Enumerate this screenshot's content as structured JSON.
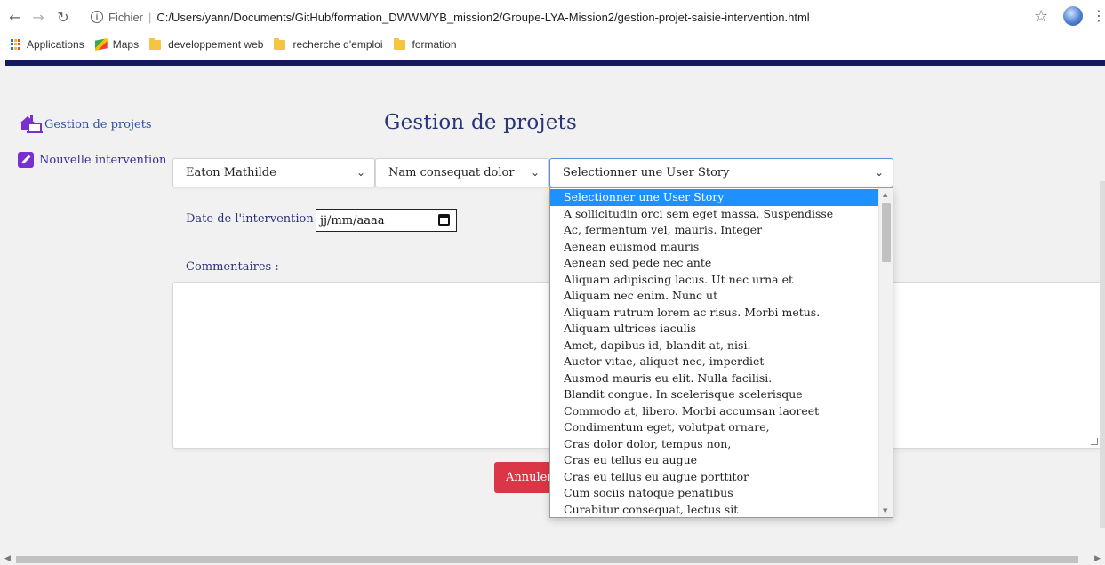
{
  "browser": {
    "url_scheme_label": "Fichier",
    "url_path": "C:/Users/yann/Documents/GitHub/formation_DWWM/YB_mission2/Groupe-LYA-Mission2/gestion-projet-saisie-intervention.html",
    "bookmarks": [
      "Applications",
      "Maps",
      "developpement web",
      "recherche d'emploi",
      "formation"
    ]
  },
  "sidebar": {
    "items": [
      {
        "label": "Gestion de projets",
        "icon": "home-icon"
      },
      {
        "label": "Nouvelle intervention",
        "icon": "edit-icon"
      }
    ]
  },
  "main": {
    "title": "Gestion de projets",
    "selects": {
      "developer": "Eaton Mathilde",
      "project": "Nam consequat dolor",
      "user_story": "Selectionner une User Story"
    },
    "date_label": "Date de l'intervention :",
    "date_placeholder": "jj/mm/aaaa",
    "comment_label": "Commentaires :",
    "comment_value": "",
    "cancel_label": "Annuler"
  },
  "dropdown": {
    "options": [
      "Selectionner une User Story",
      "A sollicitudin orci sem eget massa. Suspendisse",
      "Ac, fermentum vel, mauris. Integer",
      "Aenean euismod mauris",
      "Aenean sed pede nec ante",
      "Aliquam adipiscing lacus. Ut nec urna et",
      "Aliquam nec enim. Nunc ut",
      "Aliquam rutrum lorem ac risus. Morbi metus.",
      "Aliquam ultrices iaculis",
      "Amet, dapibus id, blandit at, nisi.",
      "Auctor vitae, aliquet nec, imperdiet",
      "Ausmod mauris eu elit. Nulla facilisi.",
      "Blandit congue. In scelerisque scelerisque",
      "Commodo at, libero. Morbi accumsan laoreet",
      "Condimentum eget, volutpat ornare,",
      "Cras dolor dolor, tempus non,",
      "Cras eu tellus eu augue",
      "Cras eu tellus eu augue porttitor",
      "Cum sociis natoque penatibus",
      "Curabitur consequat, lectus sit"
    ],
    "selected_index": 0
  },
  "colors": {
    "navy_band": "#141a5c",
    "title": "#2a3577",
    "link": "#2a51a6",
    "edit_icon": "#7a2fd1",
    "cancel_button": "#dc3545",
    "selection": "#1e90ff"
  }
}
